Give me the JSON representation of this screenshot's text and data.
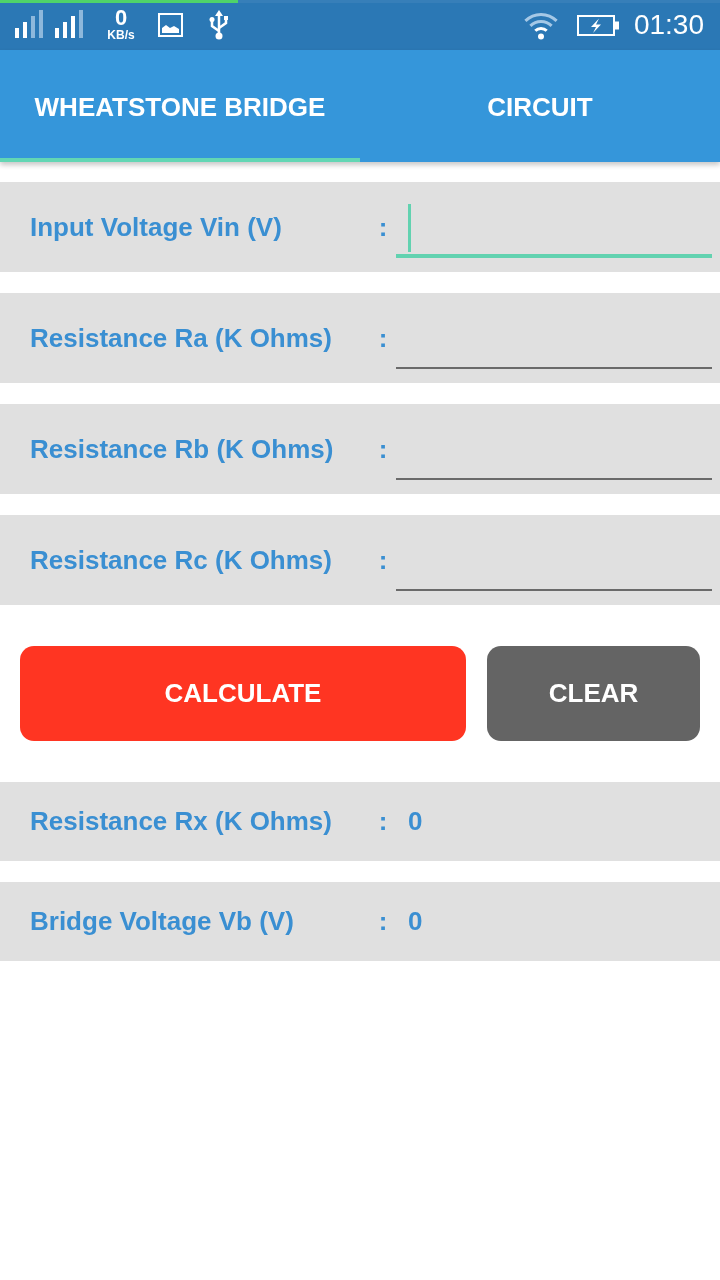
{
  "status_bar": {
    "progress": {
      "level": 0.33
    },
    "network_speed": {
      "value": "0",
      "unit": "KB/s"
    },
    "time": "01:30"
  },
  "tabs": [
    {
      "label": "WHEATSTONE BRIDGE",
      "selected": true
    },
    {
      "label": "CIRCUIT",
      "selected": false
    }
  ],
  "inputs": [
    {
      "label": "Input Voltage Vin (V)",
      "separator": ":",
      "focused": true
    },
    {
      "label": "Resistance Ra (K Ohms)",
      "separator": ":",
      "focused": false
    },
    {
      "label": "Resistance Rb (K Ohms)",
      "separator": ":",
      "focused": false
    },
    {
      "label": "Resistance Rc (K Ohms)",
      "separator": ":",
      "focused": false
    }
  ],
  "buttons": [
    {
      "label": "CALCULATE",
      "kind": "calculate"
    },
    {
      "label": "CLEAR",
      "kind": "clear"
    }
  ],
  "results": [
    {
      "label": "Resistance Rx (K Ohms)",
      "separator": ":",
      "value": "0"
    },
    {
      "label": "Bridge Voltage Vb (V)",
      "separator": ":",
      "value": "0"
    }
  ]
}
